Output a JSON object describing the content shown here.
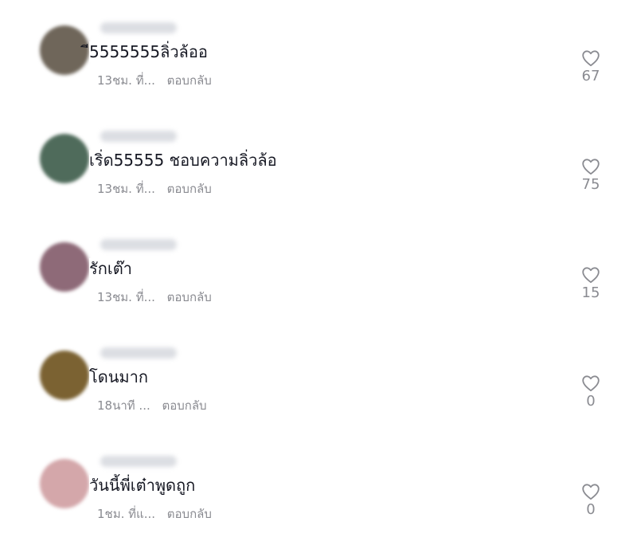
{
  "comments": [
    {
      "avatar_color": "#6f665a",
      "text": "ี5555555ลิ่วล้ออ",
      "time": "13ชม. ที่...",
      "reply_label": "ตอบกลับ",
      "like_count": "67",
      "like_icon": "heart-outline-icon"
    },
    {
      "avatar_color": "#4f6b5b",
      "text": "เริ่ด55555 ชอบความลิ่วล้อ",
      "time": "13ชม. ที่...",
      "reply_label": "ตอบกลับ",
      "like_count": "75",
      "like_icon": "heart-outline-icon"
    },
    {
      "avatar_color": "#8e6a78",
      "text": "รักเต๊า",
      "time": "13ชม. ที่...",
      "reply_label": "ตอบกลับ",
      "like_count": "15",
      "like_icon": "heart-outline-icon"
    },
    {
      "avatar_color": "#7b6232",
      "text": "โดนมาก",
      "time": "18นาที ...",
      "reply_label": "ตอบกลับ",
      "like_count": "0",
      "like_icon": "heart-outline-icon"
    },
    {
      "avatar_color": "#d4a7aa",
      "text": "วันนี้พี่เต๋าพูดถูก",
      "time": "1ชม. ที่แ...",
      "reply_label": "ตอบกลับ",
      "like_count": "0",
      "like_icon": "heart-outline-icon"
    }
  ]
}
